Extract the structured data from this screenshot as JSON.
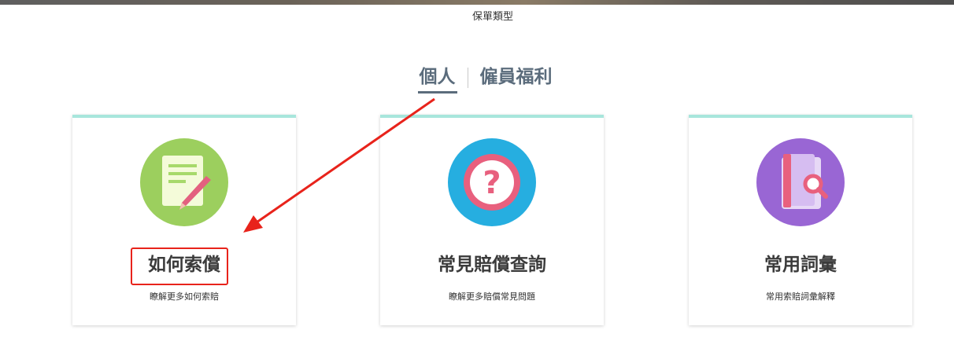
{
  "header": {
    "caption": "保單類型"
  },
  "tabs": [
    {
      "label": "個人",
      "active": true
    },
    {
      "label": "僱員福利",
      "active": false
    }
  ],
  "cards": [
    {
      "icon": "document-pencil-icon",
      "icon_bg": "#9ccf5e",
      "title": "如何索償",
      "subtitle": "瞭解更多如何索賠"
    },
    {
      "icon": "question-mark-icon",
      "icon_bg": "#26aee0",
      "title": "常見賠償查詢",
      "subtitle": "瞭解更多賠償常見問題"
    },
    {
      "icon": "glossary-book-icon",
      "icon_bg": "#9966d4",
      "title": "常用詞彙",
      "subtitle": "常用索賠詞彙解釋"
    }
  ],
  "colors": {
    "accent_top_border": "#a8e6dc",
    "tab_text": "#5b6c7c",
    "annotation_red": "#e8231b"
  }
}
